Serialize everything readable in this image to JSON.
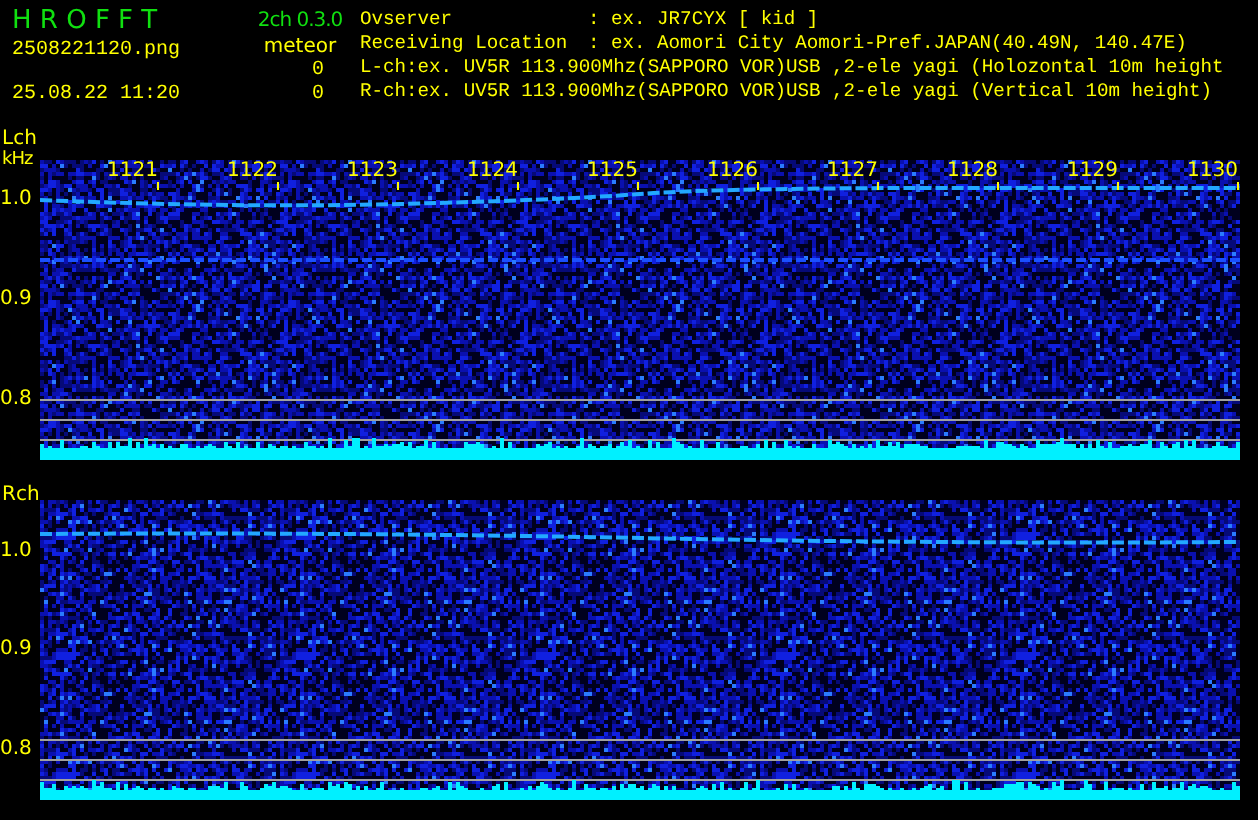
{
  "header": {
    "app_title": "H R O F F T",
    "version": "2ch 0.3.0",
    "filename": "2508221120.png",
    "mode": "meteor",
    "datetime": "25.08.22 11:20",
    "counts": [
      "0",
      "0"
    ],
    "info": [
      {
        "label": "Ovserver",
        "value": ": ex. JR7CYX [ kid ]"
      },
      {
        "label": "Receiving Location",
        "value": ": ex. Aomori City Aomori-Pref.JAPAN(40.49N, 140.47E)"
      }
    ],
    "channel_lines": [
      "L-ch:ex. UV5R 113.900Mhz(SAPPORO VOR)USB ,2-ele yagi (Holozontal 10m height",
      "R-ch:ex. UV5R 113.900Mhz(SAPPORO VOR)USB ,2-ele yagi (Vertical 10m height)"
    ]
  },
  "panels": [
    {
      "label": "Lch",
      "unit": "kHz",
      "time_labels": [
        "1121",
        "1122",
        "1123",
        "1124",
        "1125",
        "1126",
        "1127",
        "1128",
        "1129",
        "1130"
      ],
      "y_labels": [
        "1.0",
        "0.9",
        "0.8"
      ]
    },
    {
      "label": "Rch",
      "y_labels": [
        "1.0",
        "0.9",
        "0.8"
      ]
    }
  ]
}
